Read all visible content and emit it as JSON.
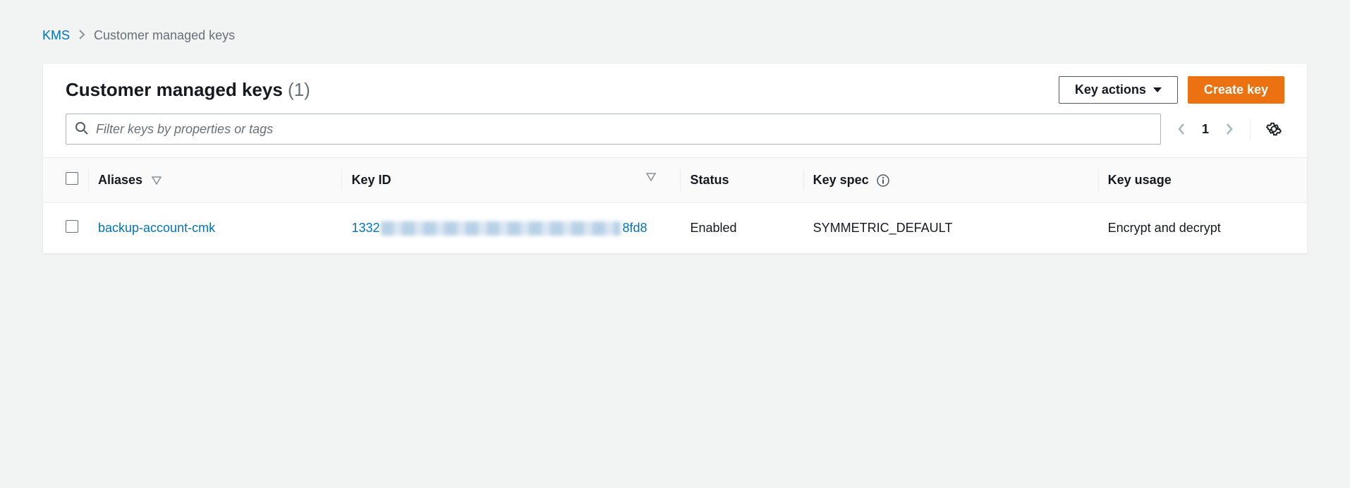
{
  "breadcrumb": {
    "root": "KMS",
    "current": "Customer managed keys"
  },
  "header": {
    "title": "Customer managed keys",
    "count": "(1)",
    "key_actions_label": "Key actions",
    "create_key_label": "Create key"
  },
  "filter": {
    "placeholder": "Filter keys by properties or tags"
  },
  "pagination": {
    "page": "1"
  },
  "table": {
    "columns": {
      "aliases": "Aliases",
      "key_id": "Key ID",
      "status": "Status",
      "key_spec": "Key spec",
      "key_usage": "Key usage"
    },
    "rows": [
      {
        "alias": "backup-account-cmk",
        "key_id_prefix": "1332",
        "key_id_suffix": "8fd8",
        "status": "Enabled",
        "key_spec": "SYMMETRIC_DEFAULT",
        "key_usage": "Encrypt and decrypt"
      }
    ]
  }
}
